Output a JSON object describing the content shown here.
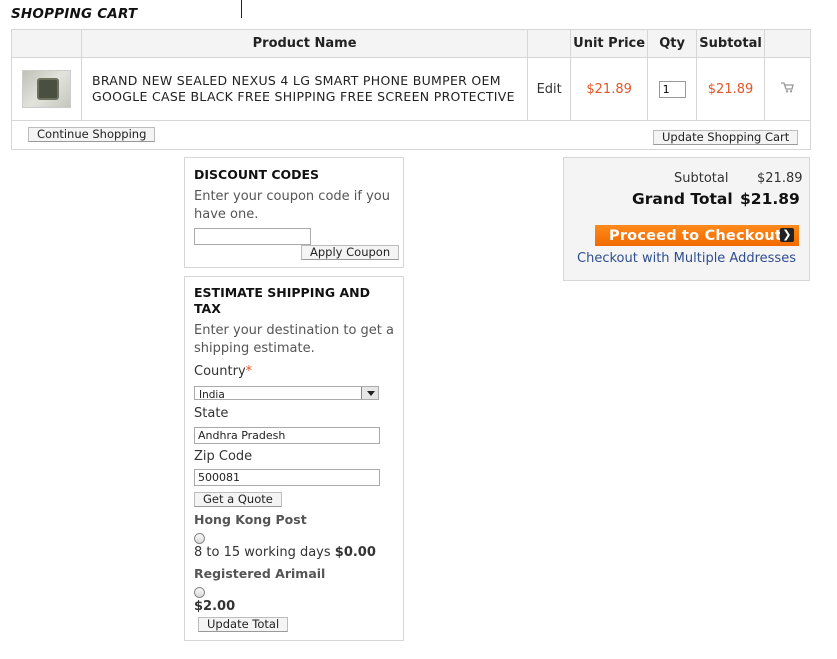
{
  "page": {
    "title": "SHOPPING CART"
  },
  "cart": {
    "headers": {
      "product_name": "Product Name",
      "unit_price": "Unit Price",
      "qty": "Qty",
      "subtotal": "Subtotal"
    },
    "items": [
      {
        "name_line1": "BRAND NEW SEALED NEXUS 4 LG SMART PHONE BUMPER OEM",
        "name_line2": "GOOGLE CASE BLACK FREE SHIPPING FREE SCREEN PROTECTIVE",
        "edit_label": "Edit",
        "unit_price": "$21.89",
        "qty": "1",
        "subtotal": "$21.89"
      }
    ],
    "continue_label": "Continue Shopping",
    "update_label": "Update Shopping Cart"
  },
  "discount": {
    "title": "DISCOUNT CODES",
    "text": "Enter your coupon code if you have one.",
    "coupon_value": "",
    "apply_label": "Apply Coupon"
  },
  "shipping": {
    "title": "ESTIMATE SHIPPING AND TAX",
    "text": "Enter your destination to get a shipping estimate.",
    "country_label": "Country",
    "required_mark": "*",
    "country_value": "India",
    "state_label": "State",
    "state_value": "Andhra Pradesh",
    "zip_label": "Zip Code",
    "zip_value": "500081",
    "quote_label": "Get a Quote",
    "methods": [
      {
        "carrier": "Hong Kong Post",
        "desc": "8 to 15 working days",
        "price": "$0.00"
      },
      {
        "carrier": "Registered Arimail",
        "desc": "",
        "price": "$2.00"
      }
    ],
    "update_total_label": "Update Total"
  },
  "totals": {
    "subtotal_label": "Subtotal",
    "subtotal_value": "$21.89",
    "grand_total_label": "Grand Total",
    "grand_total_value": "$21.89",
    "checkout_label": "Proceed to Checkout",
    "checkout_arrow": "❯",
    "multi_address_label": "Checkout with Multiple Addresses"
  },
  "colors": {
    "price": "#e2562a",
    "checkout": "#f26a00",
    "link": "#2f4e8f"
  }
}
